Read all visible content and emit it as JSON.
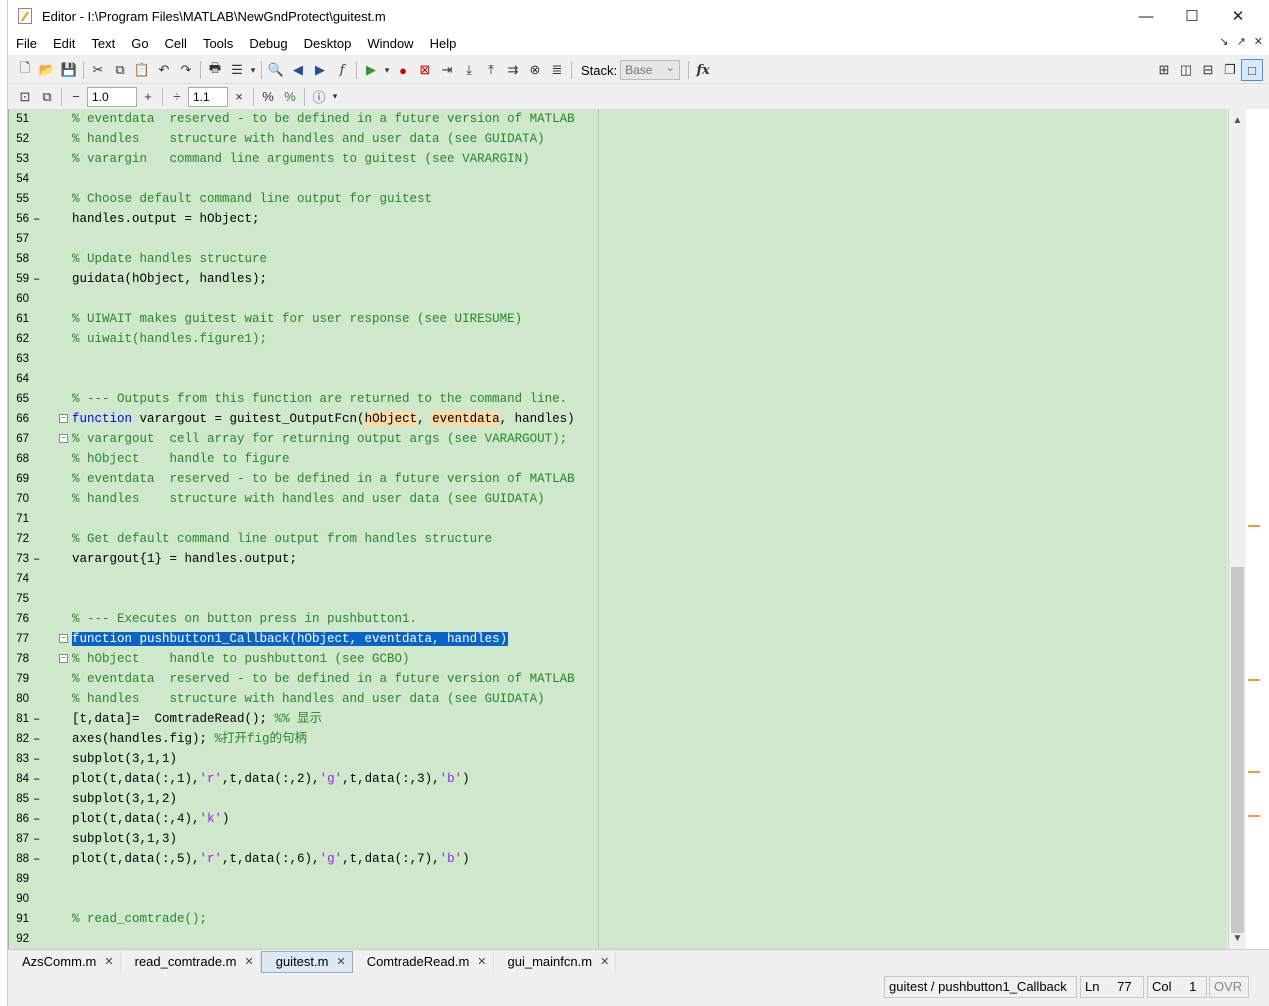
{
  "window": {
    "title": "Editor - I:\\Program Files\\MATLAB\\NewGndProtect\\guitest.m",
    "minimize": "—",
    "maximize": "☐",
    "close": "✕"
  },
  "menu": [
    "File",
    "Edit",
    "Text",
    "Go",
    "Cell",
    "Tools",
    "Debug",
    "Desktop",
    "Window",
    "Help"
  ],
  "menu_right": [
    "↘",
    "↗",
    "✕"
  ],
  "toolbar1": {
    "stack_label": "Stack:",
    "stack_value": "Base",
    "fx_label": "fx"
  },
  "toolbar2": {
    "minus": "−",
    "value1": "1.0",
    "plus": "+",
    "divide": "÷",
    "value2": "1.1",
    "times": "×"
  },
  "code_lines": [
    {
      "n": "51",
      "dash": "",
      "fold": "",
      "html": "<span class=\"c\">% eventdata  reserved - to be defined in a future version of MATLAB</span>"
    },
    {
      "n": "52",
      "dash": "",
      "fold": "",
      "html": "<span class=\"c\">% handles    structure with handles and user data (see GUIDATA)</span>"
    },
    {
      "n": "53",
      "dash": "",
      "fold": "",
      "html": "<span class=\"c\">% varargin   command line arguments to guitest (see VARARGIN)</span>"
    },
    {
      "n": "54",
      "dash": "",
      "fold": "",
      "html": ""
    },
    {
      "n": "55",
      "dash": "",
      "fold": "",
      "html": "<span class=\"c\">% Choose default command line output for guitest</span>"
    },
    {
      "n": "56",
      "dash": "–",
      "fold": "",
      "html": "handles.output = hObject;"
    },
    {
      "n": "57",
      "dash": "",
      "fold": "",
      "html": ""
    },
    {
      "n": "58",
      "dash": "",
      "fold": "",
      "html": "<span class=\"c\">% Update handles structure</span>"
    },
    {
      "n": "59",
      "dash": "–",
      "fold": "",
      "html": "guidata(hObject, handles);"
    },
    {
      "n": "60",
      "dash": "",
      "fold": "",
      "html": ""
    },
    {
      "n": "61",
      "dash": "",
      "fold": "",
      "html": "<span class=\"c\">% UIWAIT makes guitest wait for user response (see UIRESUME)</span>"
    },
    {
      "n": "62",
      "dash": "",
      "fold": "",
      "html": "<span class=\"c\">% uiwait(handles.figure1);</span>"
    },
    {
      "n": "63",
      "dash": "",
      "fold": "",
      "html": ""
    },
    {
      "n": "64",
      "dash": "",
      "fold": "",
      "html": ""
    },
    {
      "n": "65",
      "dash": "",
      "fold": "",
      "html": "<span class=\"c\">% --- Outputs from this function are returned to the command line.</span>"
    },
    {
      "n": "66",
      "dash": "",
      "fold": "−",
      "html": "<span class=\"k\">function</span> varargout = guitest_OutputFcn(<span class=\"hl\">hObject</span>, <span class=\"hl\">eventdata</span>, handles)"
    },
    {
      "n": "67",
      "dash": "",
      "fold": "−",
      "html": "<span class=\"c\">% varargout  cell array for returning output args (see VARARGOUT);</span>"
    },
    {
      "n": "68",
      "dash": "",
      "fold": "",
      "html": "<span class=\"c\">% hObject    handle to figure</span>"
    },
    {
      "n": "69",
      "dash": "",
      "fold": "",
      "html": "<span class=\"c\">% eventdata  reserved - to be defined in a future version of MATLAB</span>"
    },
    {
      "n": "70",
      "dash": "",
      "fold": "",
      "html": "<span class=\"c\">% handles    structure with handles and user data (see GUIDATA)</span>"
    },
    {
      "n": "71",
      "dash": "",
      "fold": "",
      "html": ""
    },
    {
      "n": "72",
      "dash": "",
      "fold": "",
      "html": "<span class=\"c\">% Get default command line output from handles structure</span>"
    },
    {
      "n": "73",
      "dash": "–",
      "fold": "",
      "html": "varargout{1} = handles.output;"
    },
    {
      "n": "74",
      "dash": "",
      "fold": "",
      "html": ""
    },
    {
      "n": "75",
      "dash": "",
      "fold": "",
      "html": ""
    },
    {
      "n": "76",
      "dash": "",
      "fold": "",
      "html": "<span class=\"c\">% --- Executes on button press in pushbutton1.</span>"
    },
    {
      "n": "77",
      "dash": "",
      "fold": "−",
      "html": "<span class=\"sel\">function pushbutton1_Callback(hObject, eventdata, handles)</span>"
    },
    {
      "n": "78",
      "dash": "",
      "fold": "−",
      "html": "<span class=\"c\">% hObject    handle to pushbutton1 (see GCBO)</span>"
    },
    {
      "n": "79",
      "dash": "",
      "fold": "",
      "html": "<span class=\"c\">% eventdata  reserved - to be defined in a future version of MATLAB</span>"
    },
    {
      "n": "80",
      "dash": "",
      "fold": "",
      "html": "<span class=\"c\">% handles    structure with handles and user data (see GUIDATA)</span>"
    },
    {
      "n": "81",
      "dash": "–",
      "fold": "",
      "html": "[t,data]=  ComtradeRead(); <span class=\"c\">%% 显示</span>"
    },
    {
      "n": "82",
      "dash": "–",
      "fold": "",
      "html": "axes(handles.fig); <span class=\"c\">%打开fig的句柄</span>"
    },
    {
      "n": "83",
      "dash": "–",
      "fold": "",
      "html": "subplot(3,1,1)"
    },
    {
      "n": "84",
      "dash": "–",
      "fold": "",
      "html": "plot(t,data(:,1),<span class=\"s\">'r'</span>,t,data(:,2),<span class=\"s\">'g'</span>,t,data(:,3),<span class=\"s\">'b'</span>)"
    },
    {
      "n": "85",
      "dash": "–",
      "fold": "",
      "html": "subplot(3,1,2)"
    },
    {
      "n": "86",
      "dash": "–",
      "fold": "",
      "html": "plot(t,data(:,4),<span class=\"s\">'k'</span>)"
    },
    {
      "n": "87",
      "dash": "–",
      "fold": "",
      "html": "subplot(3,1,3)"
    },
    {
      "n": "88",
      "dash": "–",
      "fold": "",
      "html": "plot(t,data(:,5),<span class=\"s\">'r'</span>,t,data(:,6),<span class=\"s\">'g'</span>,t,data(:,7),<span class=\"s\">'b'</span>)"
    },
    {
      "n": "89",
      "dash": "",
      "fold": "",
      "html": ""
    },
    {
      "n": "90",
      "dash": "",
      "fold": "",
      "html": ""
    },
    {
      "n": "91",
      "dash": "",
      "fold": "",
      "html": "<span class=\"c\">% read_comtrade();</span>"
    },
    {
      "n": "92",
      "dash": "",
      "fold": "",
      "html": ""
    }
  ],
  "tabs": [
    {
      "label": "AzsComm.m",
      "active": false
    },
    {
      "label": "read_comtrade.m",
      "active": false
    },
    {
      "label": "guitest.m",
      "active": true
    },
    {
      "label": "ComtradeRead.m",
      "active": false
    },
    {
      "label": "gui_mainfcn.m",
      "active": false
    }
  ],
  "status": {
    "function": "guitest / pushbutton1_Callback",
    "ln_label": "Ln",
    "ln_value": "77",
    "col_label": "Col",
    "col_value": "1",
    "mode": "OVR"
  },
  "colors": {
    "editor_bg": "#cfe8cc",
    "comment": "#228b22",
    "keyword": "#0000ff",
    "string": "#a020f0",
    "selection": "#0a64c8"
  }
}
